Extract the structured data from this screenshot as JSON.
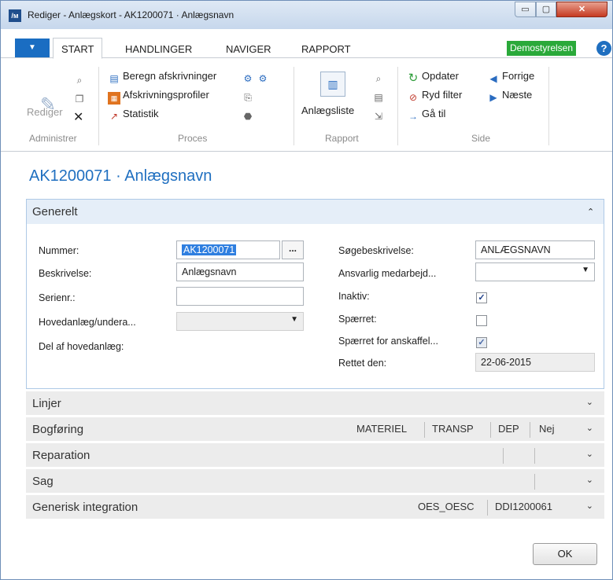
{
  "window": {
    "title": "Rediger - Anlægskort - AK1200071 · Anlægsnavn",
    "app_icon": "dynamics-nav-icon",
    "min_icon": "▭",
    "max_icon": "▢",
    "close_icon": "✕"
  },
  "ribbon_tabs": {
    "file_icon": "▼",
    "tabs": [
      "START",
      "HANDLINGER",
      "NAVIGER",
      "RAPPORT"
    ],
    "active": "START",
    "company": "Demostyrelsen",
    "help": "?"
  },
  "ribbon": {
    "administrer": {
      "label": "Administrer",
      "rediger": "Rediger"
    },
    "proces": {
      "label": "Proces",
      "beregn": "Beregn afskrivninger",
      "afskrivningsprofiler": "Afskrivningsprofiler",
      "statistik": "Statistik"
    },
    "rapport": {
      "label": "Rapport",
      "anlaegsliste": "Anlægsliste"
    },
    "side": {
      "label": "Side",
      "opdater": "Opdater",
      "ryd_filter": "Ryd filter",
      "gaa_til": "Gå til",
      "forrige": "Forrige",
      "naeste": "Næste"
    }
  },
  "page_title": "AK1200071 · Anlægsnavn",
  "generelt": {
    "title": "Generelt",
    "nummer_label": "Nummer:",
    "nummer_value": "AK1200071",
    "dots": "...",
    "beskrivelse_label": "Beskrivelse:",
    "beskrivelse_value": "Anlægsnavn",
    "serienr_label": "Serienr.:",
    "serienr_value": "",
    "hovedanlaeg_label": "Hovedanlæg/undera...",
    "hovedanlaeg_value": "",
    "del_af_label": "Del af hovedanlæg:",
    "soegebeskrivelse_label": "Søgebeskrivelse:",
    "soegebeskrivelse_value": "ANLÆGSNAVN",
    "ansvarlig_label": "Ansvarlig medarbejd...",
    "ansvarlig_value": "",
    "inaktiv_label": "Inaktiv:",
    "inaktiv_checked": true,
    "spaerret_label": "Spærret:",
    "spaerret_checked": false,
    "spaerret_anskaffel_label": "Spærret for anskaffel...",
    "spaerret_anskaffel_checked": true,
    "rettet_den_label": "Rettet den:",
    "rettet_den_value": "22-06-2015",
    "check_mark": "✓"
  },
  "fasttabs": {
    "linjer": "Linjer",
    "bogfoering": "Bogføring",
    "bogfoering_summary": [
      "MATERIEL",
      "TRANSP",
      "DEP",
      "Nej"
    ],
    "reparation": "Reparation",
    "sag": "Sag",
    "generisk": "Generisk integration",
    "generisk_summary": [
      "OES_OESC",
      "DDI1200061"
    ],
    "chevron": "⌄"
  },
  "ok_label": "OK"
}
